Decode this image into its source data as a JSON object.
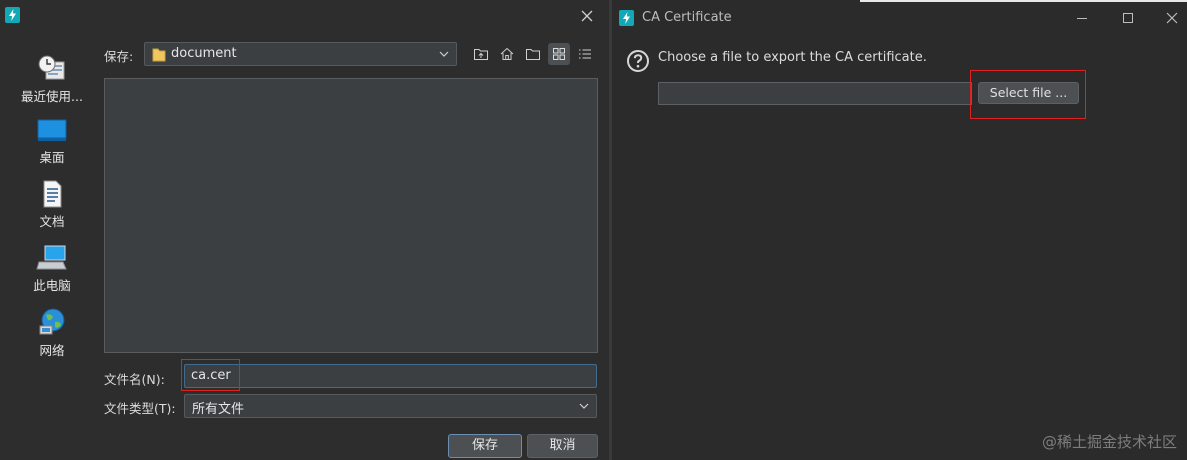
{
  "save_dialog": {
    "places": [
      {
        "label": "最近使用..."
      },
      {
        "label": "桌面"
      },
      {
        "label": "文档"
      },
      {
        "label": "此电脑"
      },
      {
        "label": "网络"
      }
    ],
    "save_in_label": "保存:",
    "save_in_value": "document",
    "filename_label": "文件名(N):",
    "filename_value": "ca.cer",
    "filetype_label": "文件类型(T):",
    "filetype_value": "所有文件",
    "save_button": "保存",
    "cancel_button": "取消"
  },
  "ca_window": {
    "title": "CA Certificate",
    "prompt": "Choose a file to export the CA certificate.",
    "path_value": "",
    "select_button": "Select file ..."
  },
  "watermark": "@稀土掘金技术社区",
  "colors": {
    "app_icon": "#13a8b5",
    "highlight": "#e02020",
    "folder": "#f0c75e",
    "monitor": "#1e90e0"
  }
}
